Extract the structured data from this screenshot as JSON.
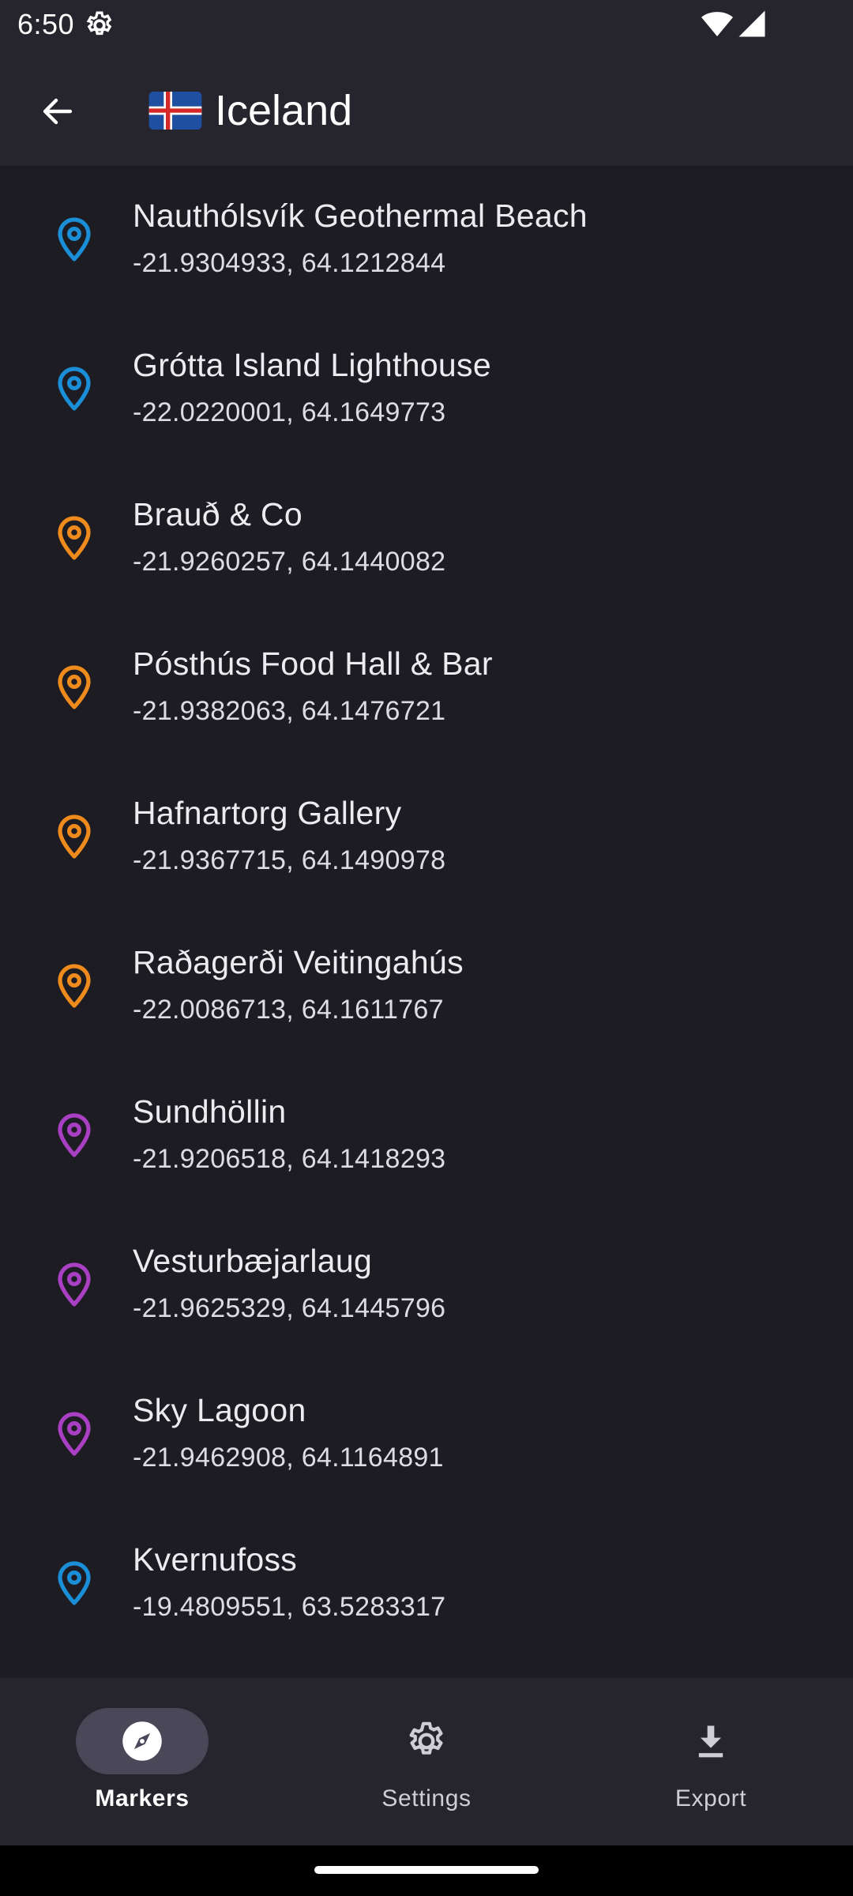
{
  "status_bar": {
    "time": "6:50",
    "icons": [
      "settings-gear-icon",
      "wifi-icon",
      "cell-signal-icon"
    ]
  },
  "app_bar": {
    "back_icon": "arrow-left-icon",
    "flag_icon": "iceland-flag-icon",
    "title": "Iceland"
  },
  "colors": {
    "blue": "#1a8fd8",
    "orange": "#ef8a1c",
    "purple": "#a93fc3"
  },
  "markers": [
    {
      "name": "Nauthólsvík Geothermal Beach",
      "coords": "-21.9304933, 64.1212844",
      "color": "#1a8fd8"
    },
    {
      "name": "Grótta Island Lighthouse",
      "coords": "-22.0220001, 64.1649773",
      "color": "#1a8fd8"
    },
    {
      "name": "Brauð & Co",
      "coords": "-21.9260257, 64.1440082",
      "color": "#ef8a1c"
    },
    {
      "name": "Pósthús Food Hall & Bar",
      "coords": "-21.9382063, 64.1476721",
      "color": "#ef8a1c"
    },
    {
      "name": "Hafnartorg Gallery",
      "coords": "-21.9367715, 64.1490978",
      "color": "#ef8a1c"
    },
    {
      "name": "Raðagerði Veitingahús",
      "coords": "-22.0086713, 64.1611767",
      "color": "#ef8a1c"
    },
    {
      "name": "Sundhöllin",
      "coords": "-21.9206518, 64.1418293",
      "color": "#a93fc3"
    },
    {
      "name": "Vesturbæjarlaug",
      "coords": "-21.9625329, 64.1445796",
      "color": "#a93fc3"
    },
    {
      "name": "Sky Lagoon",
      "coords": "-21.9462908, 64.1164891",
      "color": "#a93fc3"
    },
    {
      "name": "Kvernufoss",
      "coords": "-19.4809551, 63.5283317",
      "color": "#1a8fd8"
    }
  ],
  "bottom_nav": {
    "items": [
      {
        "label": "Markers",
        "icon": "compass-icon",
        "active": true
      },
      {
        "label": "Settings",
        "icon": "gear-icon",
        "active": false
      },
      {
        "label": "Export",
        "icon": "download-icon",
        "active": false
      }
    ]
  }
}
